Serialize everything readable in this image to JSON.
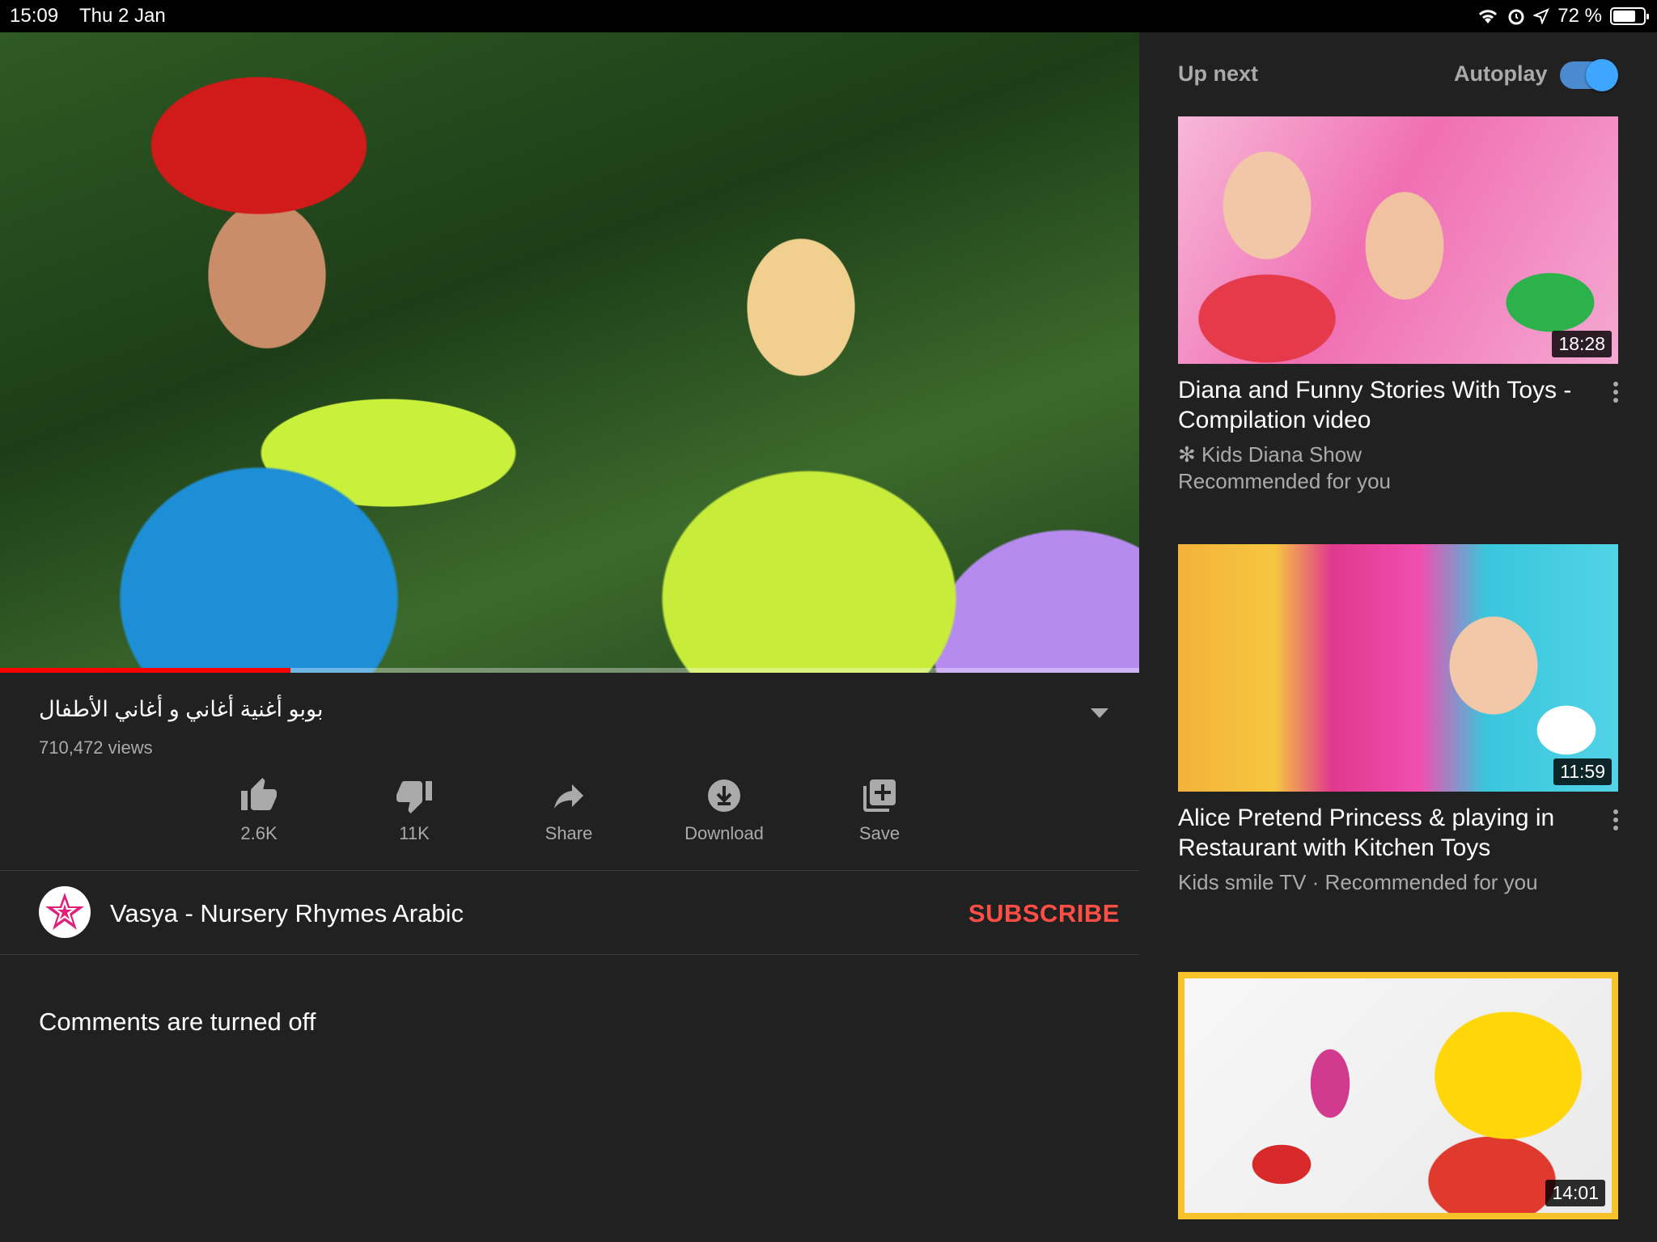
{
  "status_bar": {
    "time": "15:09",
    "date": "Thu 2 Jan",
    "battery": "72 %",
    "icons": [
      "wifi-icon",
      "alarm-icon",
      "location-icon",
      "battery-icon"
    ]
  },
  "player": {
    "progress_fraction": 0.255,
    "progress_color": "#ff0000"
  },
  "video": {
    "title": "بوبو أغنية أغاني و أغاني الأطفال",
    "views": "710,472 views"
  },
  "actions": [
    {
      "icon": "thumbs-up-icon",
      "label": "2.6K"
    },
    {
      "icon": "thumbs-down-icon",
      "label": "11K"
    },
    {
      "icon": "share-icon",
      "label": "Share"
    },
    {
      "icon": "download-icon",
      "label": "Download"
    },
    {
      "icon": "save-playlist-icon",
      "label": "Save"
    }
  ],
  "channel": {
    "name": "Vasya - Nursery Rhymes Arabic",
    "subscribe_label": "SUBSCRIBE"
  },
  "comments": {
    "status": "Comments are turned off"
  },
  "sidebar": {
    "up_next_label": "Up next",
    "autoplay_label": "Autoplay",
    "autoplay_on": true,
    "accent_color": "#3ea6ff",
    "videos": [
      {
        "title": "Diana and Funny Stories With Toys - Compilation video",
        "channel": "✻ Kids Diana Show",
        "meta": "Recommended for you",
        "duration": "18:28"
      },
      {
        "title": "Alice Pretend Princess & playing in Restaurant with Kitchen Toys",
        "channel": "Kids smile TV · Recommended for you",
        "meta": "",
        "duration": "11:59"
      },
      {
        "title": "",
        "channel": "",
        "meta": "",
        "duration": "14:01"
      }
    ]
  }
}
